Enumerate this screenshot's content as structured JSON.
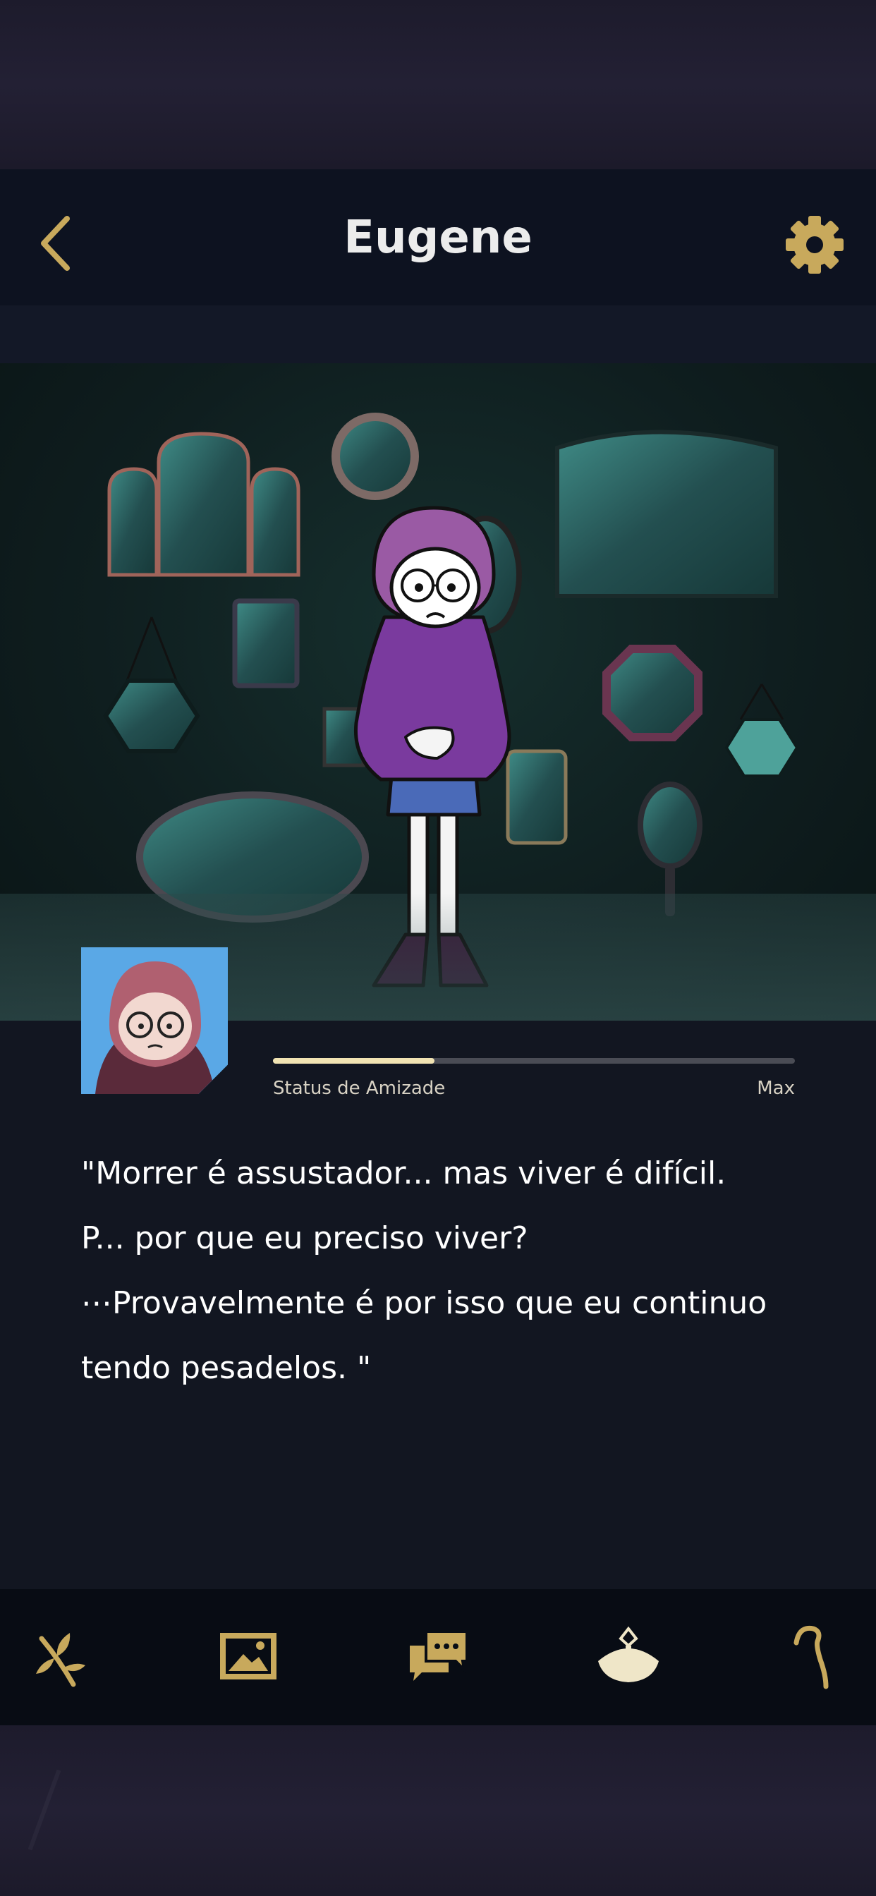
{
  "header": {
    "title": "Eugene",
    "back_icon": "chevron-left-icon",
    "settings_icon": "gear-icon"
  },
  "friendship": {
    "label": "Status de Amizade",
    "max_label": "Max",
    "level_fraction": 0.31
  },
  "quote": {
    "lines": [
      "\"Morrer é assustador... mas viver é difícil.",
      "P... por que eu preciso viver?",
      "⋯Provavelmente é por isso que eu continuo",
      "tendo pesadelos. \""
    ]
  },
  "nav": {
    "items": [
      {
        "icon": "sprout-icon"
      },
      {
        "icon": "picture-icon"
      },
      {
        "icon": "chat-icon"
      },
      {
        "icon": "lamp-icon"
      },
      {
        "icon": "cane-icon"
      }
    ]
  },
  "colors": {
    "accent_gold": "#c8a95c",
    "header_bg": "#0d1220",
    "content_bg": "#121621",
    "nav_bg": "#080c14",
    "progress_fill": "#f1e3b3"
  }
}
